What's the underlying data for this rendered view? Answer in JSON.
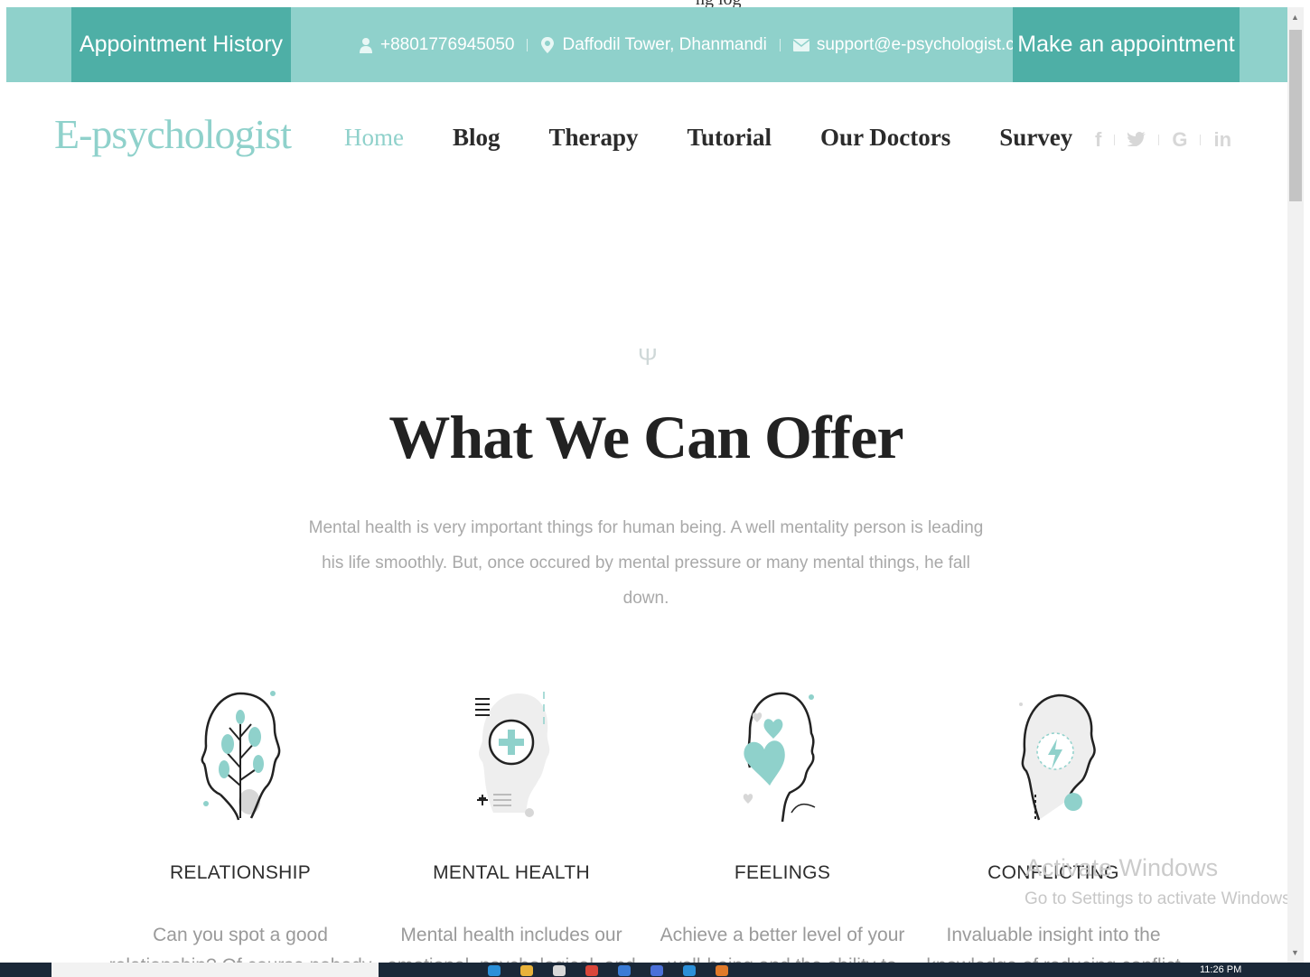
{
  "topbar": {
    "appointment_history": "Appointment History",
    "phone": "+8801776945050",
    "address": "Daffodil Tower, Dhanmandi",
    "email": "support@e-psychologist.com",
    "make_appointment": "Make an appointment",
    "accent": "#4eafa6",
    "bar_color": "#8fd1cb"
  },
  "header": {
    "logo": "E-psychologist",
    "nav": [
      "Home",
      "Blog",
      "Therapy",
      "Tutorial",
      "Our Doctors",
      "Survey"
    ],
    "active_nav": "Home",
    "social": [
      "f",
      "y",
      "G",
      "in"
    ]
  },
  "offer": {
    "symbol": "Ψ",
    "title": "What We Can Offer",
    "subtitle": "Mental health is very important things for human being. A well mentality person is leading his life smoothly. But, once occured by mental pressure or many mental things, he fall down.",
    "cards": [
      {
        "title": "RELATIONSHIP",
        "text": "Can you spot a good relationship? Of course nobody"
      },
      {
        "title": "MENTAL HEALTH",
        "text": "Mental health includes our emotional, psychological, and"
      },
      {
        "title": "FEELINGS",
        "text": "Achieve a better level of your well-being and the ability to"
      },
      {
        "title": "CONFLICTING",
        "text": "Invaluable insight into the knowledge of reducing conflict"
      }
    ]
  },
  "watermark": {
    "line1": "Activate Windows",
    "line2": "Go to Settings to activate Windows."
  },
  "taskbar": {
    "clock": "11:26 PM"
  },
  "clipped_text": "ng log"
}
